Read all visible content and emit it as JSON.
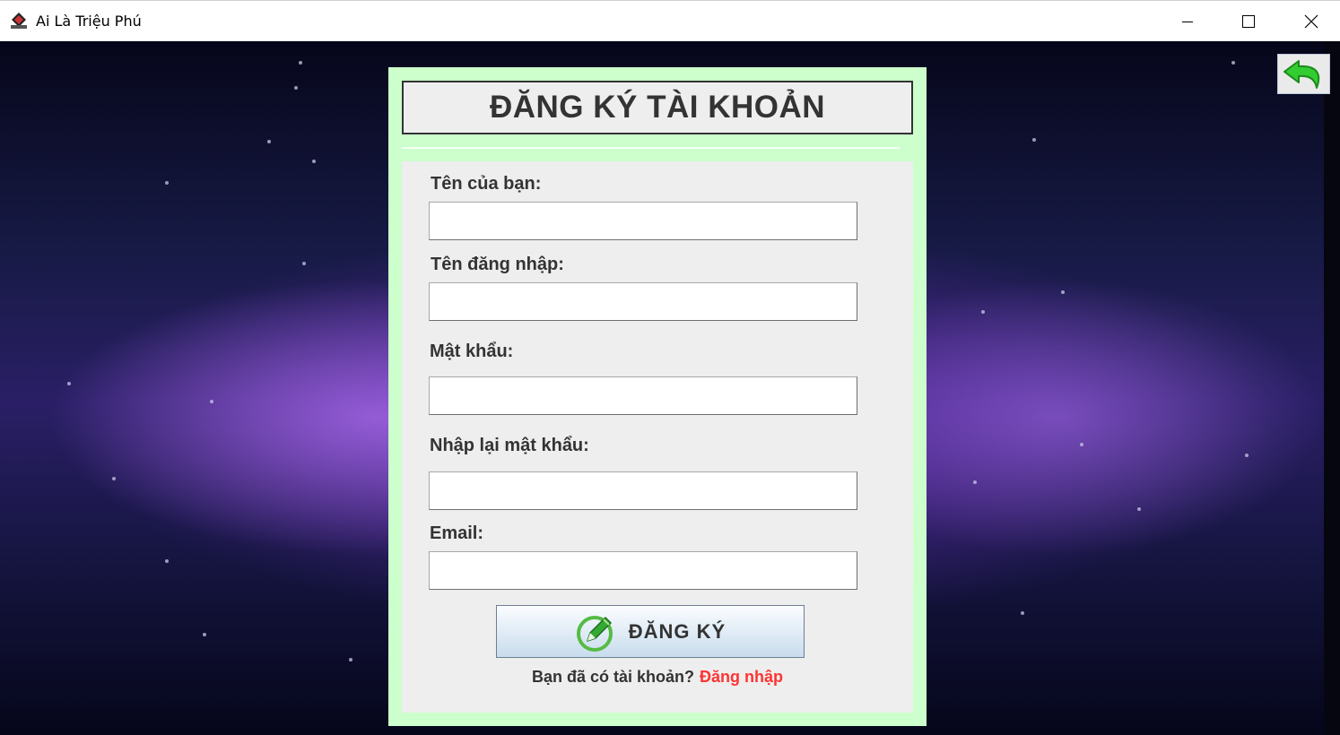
{
  "window": {
    "title": "Ai Là Triệu Phú",
    "app_icon": "app-icon",
    "controls": [
      "minimize-icon",
      "maximize-icon",
      "close-icon"
    ]
  },
  "back_button": {
    "icon": "back-arrow-icon",
    "color": "#33cc33"
  },
  "form": {
    "title": "ĐĂNG KÝ TÀI KHOẢN",
    "fields": {
      "name_label": "Tên của bạn:",
      "name_value": "",
      "username_label": "Tên đăng nhập:",
      "username_value": "",
      "password_label": "Mật khẩu:",
      "password_value": "",
      "confirm_label": "Nhập lại mật khẩu:",
      "confirm_value": "",
      "email_label": "Email:",
      "email_value": ""
    },
    "submit": {
      "label": "ĐĂNG KÝ",
      "icon": "pen-icon"
    },
    "footer": {
      "question": "Bạn đã có tài khoản?",
      "link": "Đăng nhập"
    }
  },
  "colors": {
    "panel_bg": "#ccffcc",
    "form_bg": "#eeeeee",
    "text": "#333333",
    "link": "#ff3333"
  }
}
